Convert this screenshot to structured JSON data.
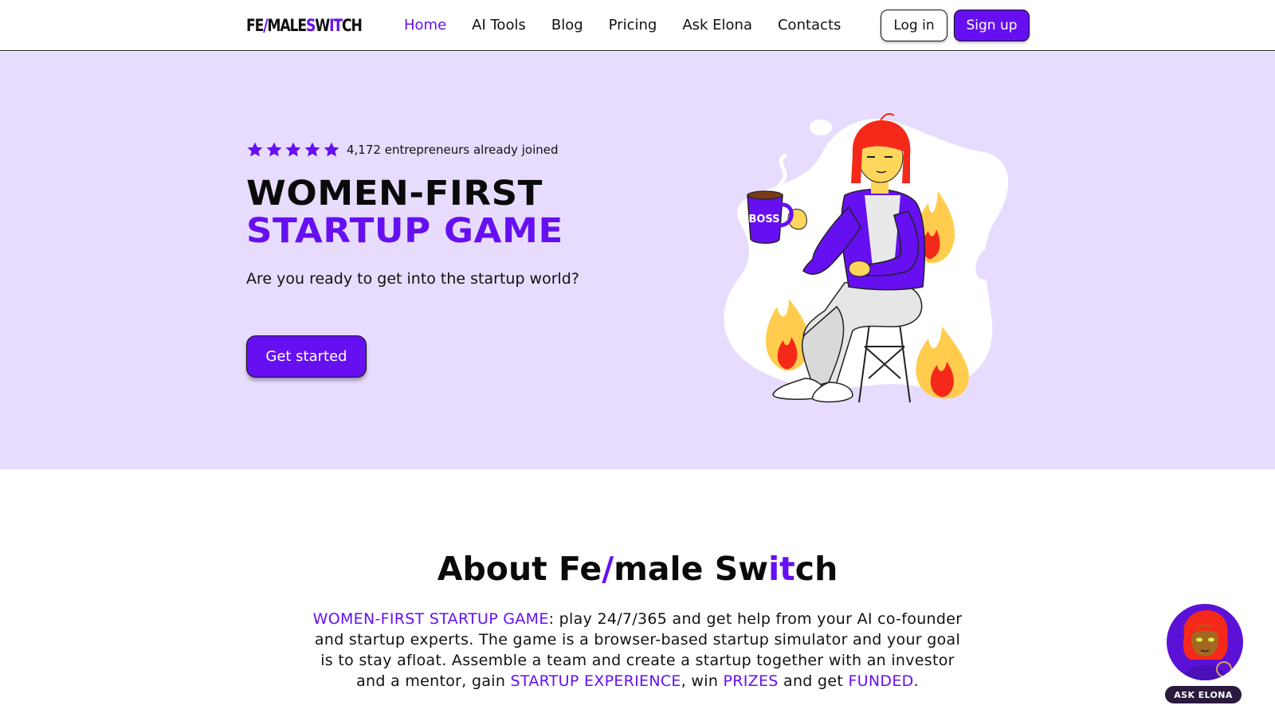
{
  "header": {
    "logo": {
      "part1": "FE",
      "slash": "/",
      "part2": "MALE ",
      "s": "S",
      "w": "W",
      "it": "IT",
      "ch": "CH"
    },
    "nav": [
      {
        "label": "Home",
        "active": true
      },
      {
        "label": "AI Tools",
        "active": false
      },
      {
        "label": "Blog",
        "active": false
      },
      {
        "label": "Pricing",
        "active": false
      },
      {
        "label": "Ask Elona",
        "active": false
      },
      {
        "label": "Contacts",
        "active": false
      }
    ],
    "login_label": "Log in",
    "signup_label": "Sign up"
  },
  "hero": {
    "rating_stars": 5,
    "rating_text": "4,172 entrepreneurs already joined",
    "title_line1": "WOMEN-FIRST",
    "title_line2": "STARTUP GAME",
    "subtitle": "Are you ready to get into the startup world?",
    "cta_label": "Get started",
    "mug_text": "BOSS"
  },
  "about": {
    "title_part1": "About Fe",
    "title_slash": "/",
    "title_part2": "male Sw",
    "title_it": "it",
    "title_part3": "ch",
    "text": {
      "hl1": "WOMEN-FIRST STARTUP GAME",
      "t1": ": play 24/7/365 and get help from your AI co-founder and startup experts. The game is a browser-based startup simulator and your goal is to stay afloat. Assemble a team and create a startup together with an investor and a mentor, gain ",
      "hl2": "STARTUP EXPERIENCE",
      "t2": ", win ",
      "hl3": "PRIZES",
      "t3": " and get ",
      "hl4": "FUNDED",
      "t4": "."
    }
  },
  "widget": {
    "label": "ASK ELONA"
  },
  "colors": {
    "accent": "#6610f2",
    "hero_bg": "#e7dcfd",
    "flame": "#ffcc4d",
    "hair": "#f5291a"
  }
}
